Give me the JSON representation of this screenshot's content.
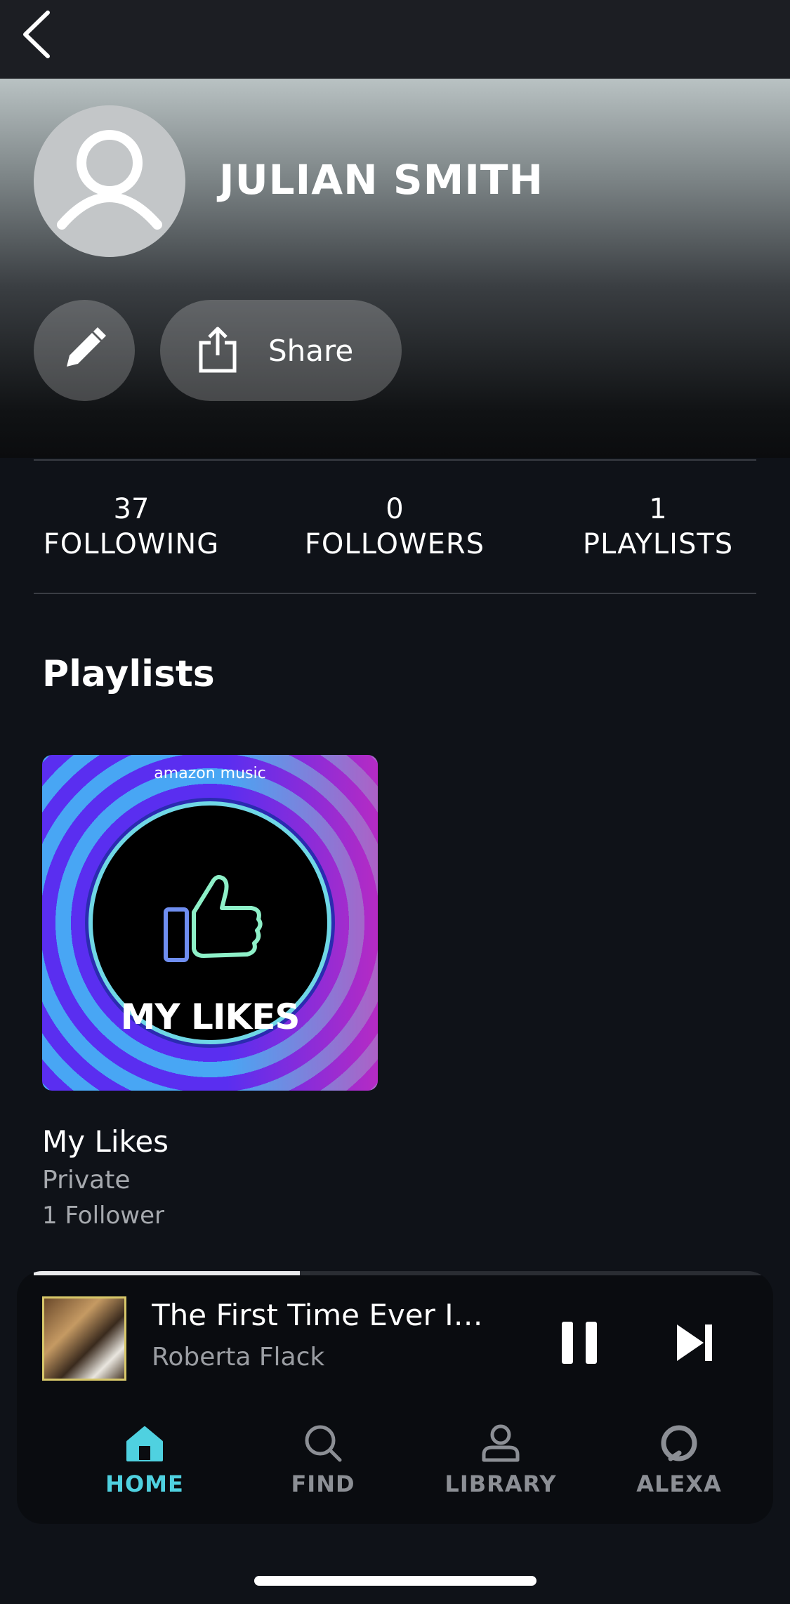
{
  "profile": {
    "name": "JULIAN SMITH",
    "share_label": "Share"
  },
  "stats": [
    {
      "count": "37",
      "label": "FOLLOWING"
    },
    {
      "count": "0",
      "label": "FOLLOWERS"
    },
    {
      "count": "1",
      "label": "PLAYLISTS"
    }
  ],
  "playlists_section": {
    "title": "Playlists",
    "items": [
      {
        "art_brand": "amazon music",
        "art_title": "MY LIKES",
        "name": "My Likes",
        "privacy": "Private",
        "followers": "1 Follower"
      }
    ]
  },
  "now_playing": {
    "title": "The First Time Ever I…",
    "artist": "Roberta Flack",
    "progress": 0.36
  },
  "nav": {
    "items": [
      {
        "label": "HOME",
        "icon": "home-icon",
        "active": true
      },
      {
        "label": "FIND",
        "icon": "search-icon",
        "active": false
      },
      {
        "label": "LIBRARY",
        "icon": "library-icon",
        "active": false
      },
      {
        "label": "ALEXA",
        "icon": "alexa-icon",
        "active": false
      }
    ]
  },
  "colors": {
    "accent": "#4fd1e0",
    "background": "#0f1218",
    "muted_text": "#a6a9ae"
  }
}
